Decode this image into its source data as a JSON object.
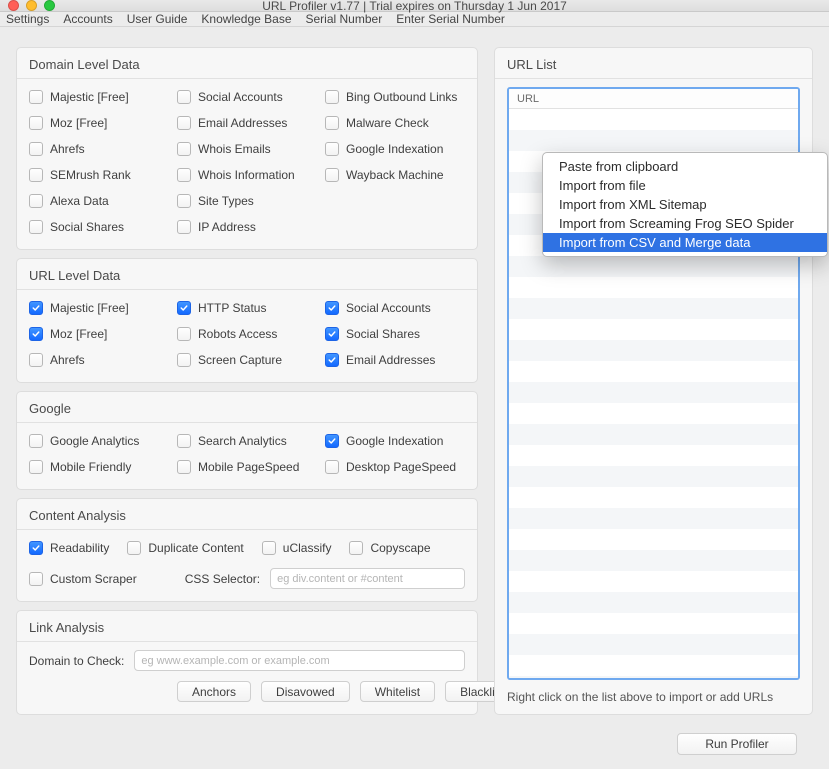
{
  "window": {
    "title": "URL Profiler v1.77 | Trial expires on Thursday 1 Jun 2017"
  },
  "menubar": [
    "Settings",
    "Accounts",
    "User Guide",
    "Knowledge Base",
    "Serial Number",
    "Enter Serial Number"
  ],
  "groups": {
    "domain": {
      "title": "Domain Level Data",
      "items": [
        {
          "label": "Majestic [Free]",
          "checked": false
        },
        {
          "label": "Social Accounts",
          "checked": false
        },
        {
          "label": "Bing Outbound Links",
          "checked": false
        },
        {
          "label": "Moz [Free]",
          "checked": false
        },
        {
          "label": "Email Addresses",
          "checked": false
        },
        {
          "label": "Malware Check",
          "checked": false
        },
        {
          "label": "Ahrefs",
          "checked": false
        },
        {
          "label": "Whois Emails",
          "checked": false
        },
        {
          "label": "Google Indexation",
          "checked": false
        },
        {
          "label": "SEMrush Rank",
          "checked": false
        },
        {
          "label": "Whois Information",
          "checked": false
        },
        {
          "label": "Wayback Machine",
          "checked": false
        },
        {
          "label": "Alexa Data",
          "checked": false
        },
        {
          "label": "Site Types",
          "checked": false
        },
        {
          "label": "",
          "checked": false,
          "empty": true
        },
        {
          "label": "Social Shares",
          "checked": false
        },
        {
          "label": "IP Address",
          "checked": false
        }
      ]
    },
    "url": {
      "title": "URL Level Data",
      "items": [
        {
          "label": "Majestic [Free]",
          "checked": true
        },
        {
          "label": "HTTP Status",
          "checked": true
        },
        {
          "label": "Social Accounts",
          "checked": true
        },
        {
          "label": "Moz [Free]",
          "checked": true
        },
        {
          "label": "Robots Access",
          "checked": false
        },
        {
          "label": "Social Shares",
          "checked": true
        },
        {
          "label": "Ahrefs",
          "checked": false
        },
        {
          "label": "Screen Capture",
          "checked": false
        },
        {
          "label": "Email Addresses",
          "checked": true
        }
      ]
    },
    "google": {
      "title": "Google",
      "items": [
        {
          "label": "Google Analytics",
          "checked": false
        },
        {
          "label": "Search Analytics",
          "checked": false
        },
        {
          "label": "Google Indexation",
          "checked": true
        },
        {
          "label": "Mobile Friendly",
          "checked": false
        },
        {
          "label": "Mobile PageSpeed",
          "checked": false
        },
        {
          "label": "Desktop PageSpeed",
          "checked": false
        }
      ]
    },
    "content": {
      "title": "Content Analysis",
      "row1": [
        {
          "label": "Readability",
          "checked": true
        },
        {
          "label": "Duplicate Content",
          "checked": false
        },
        {
          "label": "uClassify",
          "checked": false
        },
        {
          "label": "Copyscape",
          "checked": false
        }
      ],
      "custom": {
        "label": "Custom Scraper",
        "checked": false
      },
      "css_label": "CSS Selector:",
      "css_placeholder": "eg div.content or #content"
    },
    "link": {
      "title": "Link Analysis",
      "domain_label": "Domain to Check:",
      "domain_placeholder": "eg www.example.com or example.com",
      "buttons": [
        "Anchors",
        "Disavowed",
        "Whitelist",
        "Blacklist"
      ]
    },
    "url_list": {
      "title": "URL List",
      "column": "URL",
      "hint": "Right click on the list above to import or add URLs"
    }
  },
  "context_menu": [
    {
      "label": "Paste from clipboard",
      "hl": false
    },
    {
      "label": "Import from file",
      "hl": false
    },
    {
      "label": "Import from XML Sitemap",
      "hl": false
    },
    {
      "label": "Import from Screaming Frog SEO Spider",
      "hl": false
    },
    {
      "label": "Import from CSV and Merge data",
      "hl": true
    }
  ],
  "run_button": "Run Profiler"
}
